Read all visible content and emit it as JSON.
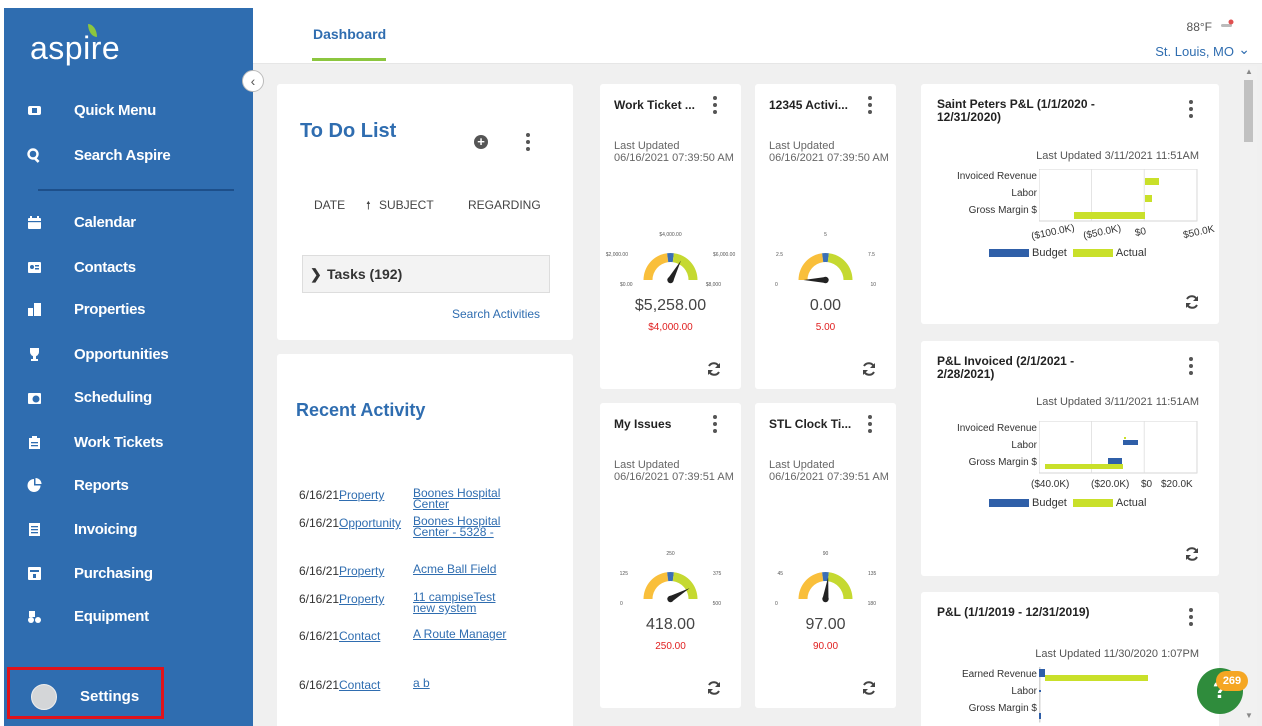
{
  "brand": {
    "name": "aspire",
    "accent": "#2f6db0",
    "leaf": "#8cc63f"
  },
  "sidebar": {
    "items": [
      {
        "label": "Quick Menu",
        "icon": "quick-menu-icon"
      },
      {
        "label": "Search Aspire",
        "icon": "search-icon"
      },
      {
        "label": "Calendar",
        "icon": "calendar-icon"
      },
      {
        "label": "Contacts",
        "icon": "contacts-icon"
      },
      {
        "label": "Properties",
        "icon": "properties-icon"
      },
      {
        "label": "Opportunities",
        "icon": "trophy-icon"
      },
      {
        "label": "Scheduling",
        "icon": "scheduling-icon"
      },
      {
        "label": "Work Tickets",
        "icon": "clipboard-icon"
      },
      {
        "label": "Reports",
        "icon": "pie-chart-icon"
      },
      {
        "label": "Invoicing",
        "icon": "invoice-icon"
      },
      {
        "label": "Purchasing",
        "icon": "purchasing-icon"
      },
      {
        "label": "Equipment",
        "icon": "equipment-icon"
      }
    ],
    "settings_label": "Settings",
    "collapse_glyph": "‹"
  },
  "header": {
    "tab": "Dashboard",
    "temperature": "88°F",
    "location": "St. Louis, MO",
    "location_chevron": "⌄"
  },
  "todo": {
    "title": "To Do List",
    "add_glyph": "+",
    "columns": [
      "DATE",
      "SUBJECT",
      "REGARDING"
    ],
    "sort_glyph": "🠕",
    "tasks_label": "Tasks (192)",
    "tasks_chevron": "❯",
    "search_link": "Search Activities"
  },
  "recent": {
    "title": "Recent Activity",
    "rows": [
      {
        "date": "6/16/21",
        "type": "Property",
        "name": "Boones Hospital Center"
      },
      {
        "date": "6/16/21",
        "type": "Opportunity",
        "name": "Boones Hospital Center - 5328 -"
      },
      {
        "date": "6/16/21",
        "type": "Property",
        "name": "Acme Ball Field"
      },
      {
        "date": "6/16/21",
        "type": "Property",
        "name": "11 campiseTest new system"
      },
      {
        "date": "6/16/21",
        "type": "Contact",
        "name": "A Route Manager"
      },
      {
        "date": "6/16/21",
        "type": "Contact",
        "name": "a b"
      }
    ]
  },
  "widgets": [
    {
      "title": "Work Ticket ...",
      "updated": "Last Updated 06/16/2021 07:39:50 AM",
      "value": "$5,258.00",
      "target": "$4,000.00",
      "ticks": [
        "$0.00",
        "$2,000.00",
        "$4,000.00",
        "$6,000.00",
        "$8,000"
      ],
      "gauge": {
        "min": 0,
        "max": 8000,
        "target": 4000,
        "value": 5258
      }
    },
    {
      "title": "12345 Activi...",
      "updated": "Last Updated 06/16/2021 07:39:50 AM",
      "value": "0.00",
      "target": "5.00",
      "ticks": [
        "0",
        "2.5",
        "5",
        "7.5",
        "10"
      ],
      "gauge": {
        "min": 0,
        "max": 10,
        "target": 5,
        "value": 0
      }
    },
    {
      "title": "My Issues",
      "updated": "Last Updated 06/16/2021 07:39:51 AM",
      "value": "418.00",
      "target": "250.00",
      "ticks": [
        "0",
        "125",
        "250",
        "375",
        "500"
      ],
      "gauge": {
        "min": 0,
        "max": 500,
        "target": 250,
        "value": 418
      }
    },
    {
      "title": "STL Clock Ti...",
      "updated": "Last Updated 06/16/2021 07:39:51 AM",
      "value": "97.00",
      "target": "90.00",
      "ticks": [
        "0",
        "45",
        "90",
        "135",
        "180"
      ],
      "gauge": {
        "min": 0,
        "max": 180,
        "target": 90,
        "value": 97
      }
    }
  ],
  "pl": [
    {
      "title": "Saint Peters P&L (1/1/2020 - 12/31/2020)",
      "updated": "Last Updated 3/11/2021 11:51AM",
      "rows": [
        "Invoiced Revenue",
        "Labor",
        "Gross Margin $"
      ],
      "ticks": [
        "($100.0K)",
        "($50.0K)",
        "$0",
        "$50.0K"
      ],
      "legend": [
        "Budget",
        "Actual"
      ]
    },
    {
      "title": "P&L Invoiced (2/1/2021 - 2/28/2021)",
      "updated": "Last Updated 3/11/2021 11:51AM",
      "rows": [
        "Invoiced Revenue",
        "Labor",
        "Gross Margin $"
      ],
      "ticks": [
        "($40.0K)",
        "($20.0K)",
        "$0",
        "$20.0K"
      ],
      "legend": [
        "Budget",
        "Actual"
      ]
    },
    {
      "title": "P&L (1/1/2019 - 12/31/2019)",
      "updated": "Last Updated 11/30/2020 1:07PM",
      "rows": [
        "Earned Revenue",
        "Labor",
        "Gross Margin $"
      ]
    }
  ],
  "help": {
    "glyph": "?",
    "count": "269"
  },
  "colors": {
    "gauge_yellow": "#f9bf3b",
    "gauge_blue": "#3b6fb6",
    "gauge_green": "#c5d931",
    "budget": "#2f5fa8",
    "actual": "#c9e02a",
    "target_red": "#e02020"
  }
}
